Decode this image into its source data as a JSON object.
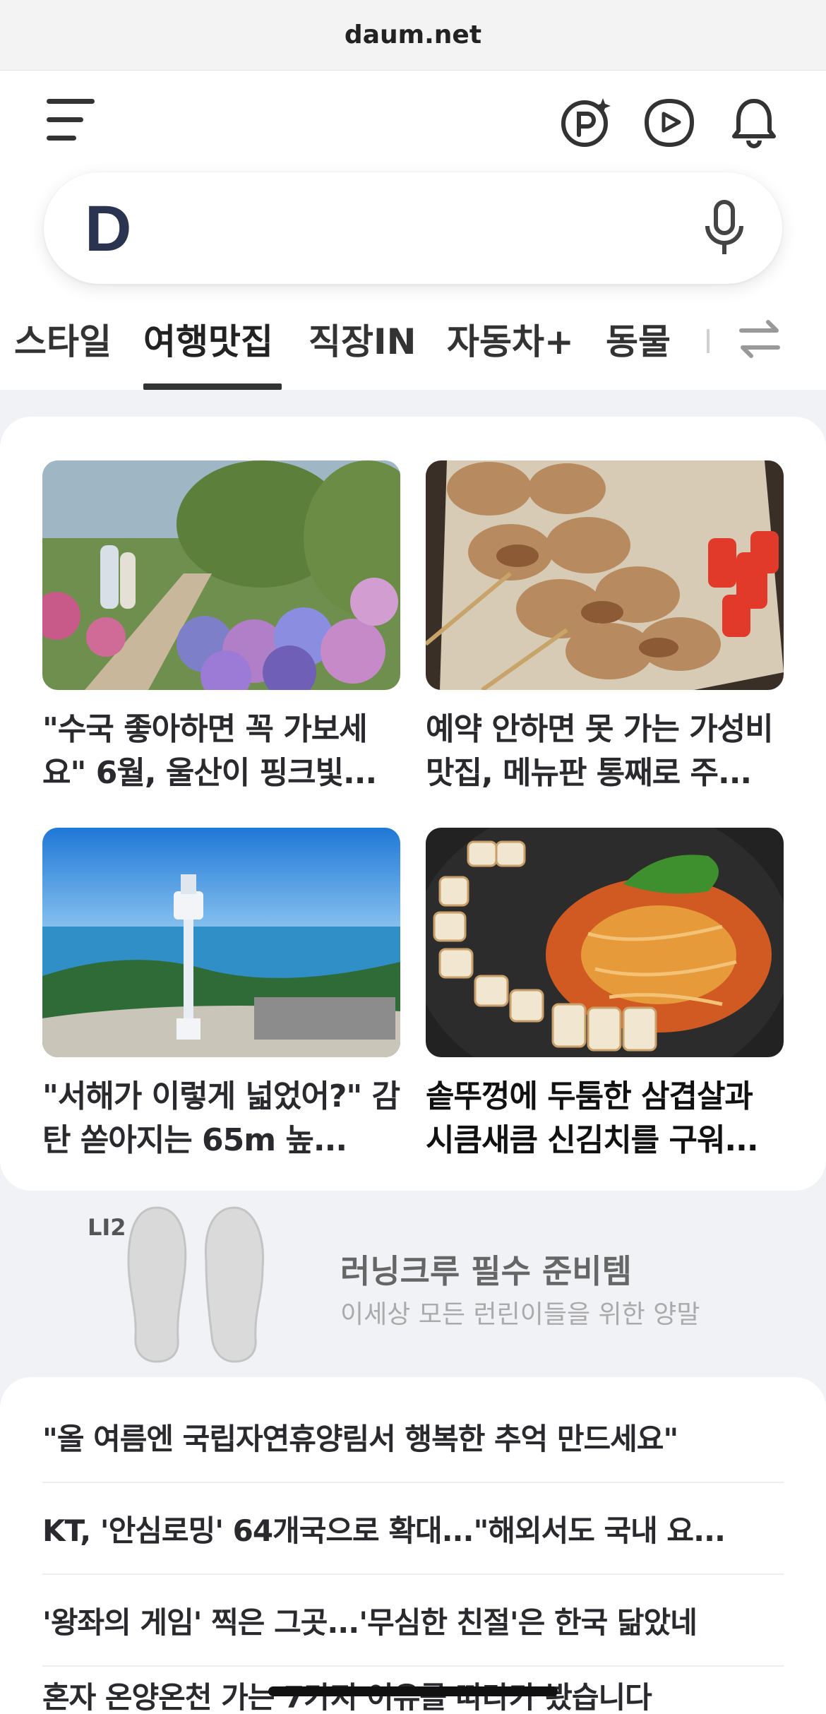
{
  "browser": {
    "url": "daum.net"
  },
  "header": {
    "menu_icon": "hamburger-menu-icon",
    "icons": [
      "pay-icon",
      "video-play-icon",
      "notification-bell-icon"
    ]
  },
  "search": {
    "logo": "D",
    "mic_icon": "microphone-icon",
    "placeholder": ""
  },
  "tabs": [
    {
      "label": "스타일",
      "active": false
    },
    {
      "label": "여행맛집",
      "active": true
    },
    {
      "label": "직장IN",
      "active": false
    },
    {
      "label": "자동차+",
      "active": false
    },
    {
      "label": "동물",
      "active": false
    }
  ],
  "tabs_edit_icon": "swap-arrows-icon",
  "news_grid": [
    {
      "title": "\"수국 좋아하면 꼭 가보세요\" 6월, 울산이 핑크빛...",
      "image": "hydrangea-path-photo"
    },
    {
      "title": "예약 안하면 못 가는 가성비 맛집, 메뉴판 통째로 주...",
      "image": "grilled-skewer-photo"
    },
    {
      "title": "\"서해가 이렇게 넓었어?\" 감탄 쏟아지는 65m 높...",
      "image": "seaside-tower-photo"
    },
    {
      "title": "솥뚜껑에 두툼한 삼겹살과 시큼새큼 신김치를 구워...",
      "image": "pork-belly-kimchi-photo"
    }
  ],
  "ad": {
    "brand": "LI2",
    "title": "러닝크루 필수 준비템",
    "subtitle": "이세상 모든 런린이들을 위한 양말",
    "image": "insole-product-photo"
  },
  "news_list": [
    "\"올 여름엔 국립자연휴양림서 행복한 추억 만드세요\"",
    "KT, '안심로밍' 64개국으로 확대...\"해외서도 국내 요...",
    "'왕좌의 게임' 찍은 그곳...'무심한 친절'은 한국 닮았네",
    "혼자 온양온천 가는 7가지 이유를 따라가 봤습니다"
  ]
}
